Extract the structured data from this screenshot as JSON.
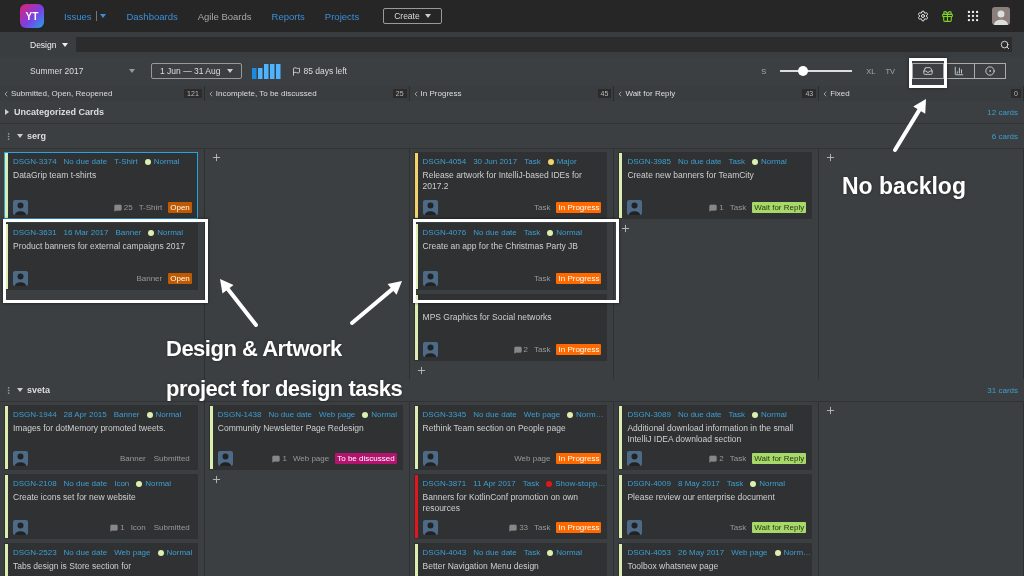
{
  "nav": {
    "logo": "YT",
    "links": [
      {
        "label": "Issues",
        "selected": false,
        "dropdown": true
      },
      {
        "label": "Dashboards",
        "selected": false
      },
      {
        "label": "Agile Boards",
        "selected": true
      },
      {
        "label": "Reports",
        "selected": false
      },
      {
        "label": "Projects",
        "selected": false
      }
    ],
    "create_button": "Create"
  },
  "search": {
    "project": "Design"
  },
  "toolbar": {
    "sprint": "Summer 2017",
    "dates": "1 Jun — 31 Aug",
    "days_left": "85 days left",
    "size_min": "S",
    "size_max": "XL",
    "tv": "TV",
    "level": 0.32
  },
  "columns": [
    {
      "title": "Submitted, Open, Reopened",
      "count": "121"
    },
    {
      "title": "Incomplete, To be discussed",
      "count": "25"
    },
    {
      "title": "In Progress",
      "count": "45"
    },
    {
      "title": "Wait for Reply",
      "count": "43"
    },
    {
      "title": "Fixed",
      "count": "0"
    }
  ],
  "uncategorized": {
    "title": "Uncategorized Cards",
    "count": "12 cards",
    "expanded": false
  },
  "swimlanes": [
    {
      "name": "serg",
      "count": "6 cards",
      "expanded": true,
      "cells": [
        {
          "add": false,
          "cards": [
            {
              "id": "DSGN-3374",
              "date": "No due date",
              "type": "T-Shirt",
              "priority": "Normal",
              "color": "#dcefb0",
              "title": "DataGrip team t-shirts",
              "comments": "25",
              "tag": "T-Shirt",
              "state": {
                "text": "Open",
                "color": "#c05a00"
              },
              "selected": true
            },
            {
              "id": "DSGN-3631",
              "date": "16 Mar 2017",
              "type": "Banner",
              "priority": "Normal",
              "color": "#dcefb0",
              "title": "Product banners for external campaigns 2017",
              "tag": "Banner",
              "state": {
                "text": "Open",
                "color": "#c05a00"
              },
              "selected": false
            }
          ]
        },
        {
          "add": true
        },
        {
          "add": true,
          "cards": [
            {
              "id": "DSGN-4054",
              "date": "30 Jun 2017",
              "type": "Task",
              "priority": "Major",
              "color": "#f2d56a",
              "title": "Release artwork for IntelliJ-based IDEs for 2017.2",
              "tag": "Task",
              "state": {
                "text": "In Progress",
                "color": "#ff6a00"
              },
              "selected": false
            },
            {
              "id": "DSGN-4076",
              "date": "No due date",
              "type": "Task",
              "priority": "Normal",
              "color": "#dcefb0",
              "title": "Create an app for the Christmas Party JB",
              "tag": "Task",
              "state": {
                "text": "In Progress",
                "color": "#ff6a00"
              },
              "selected": false
            },
            {
              "color": "#dcefb0",
              "title": "MPS Graphics for Social networks",
              "comments": "2",
              "tag": "Task",
              "state": {
                "text": "In Progress",
                "color": "#ff6a00"
              },
              "selected": false
            }
          ]
        },
        {
          "add": true,
          "cards": [
            {
              "id": "DSGN-3985",
              "date": "No due date",
              "type": "Task",
              "priority": "Normal",
              "color": "#dcefb0",
              "title": "Create new banners for TeamCity",
              "comments": "1",
              "tag": "Task",
              "state": {
                "text": "Wait for Reply",
                "color": "#a6d96a"
              },
              "selected": false
            }
          ]
        },
        {
          "add": true
        }
      ]
    },
    {
      "name": "sveta",
      "count": "31 cards",
      "expanded": true,
      "cells": [
        {
          "add": false,
          "cards": [
            {
              "id": "DSGN-1944",
              "date": "28 Apr 2015",
              "type": "Banner",
              "priority": "Normal",
              "color": "#dcefb0",
              "title": "Images for dotMemory promoted tweets.",
              "tag": "Banner",
              "state": {
                "text": "Submitted"
              },
              "selected": false
            },
            {
              "id": "DSGN-2108",
              "date": "No due date",
              "type": "Icon",
              "priority": "Normal",
              "color": "#dcefb0",
              "title": "Create icons set for new website",
              "comments": "1",
              "tag": "Icon",
              "state": {
                "text": "Submitted"
              },
              "selected": false
            },
            {
              "id": "DSGN-2523",
              "date": "No due date",
              "type": "Web page",
              "priority": "Normal",
              "color": "#dcefb0",
              "title": "Tabs design is Store section for",
              "selected": false
            }
          ]
        },
        {
          "add": true,
          "cards": [
            {
              "id": "DSGN-1438",
              "date": "No due date",
              "type": "Web page",
              "priority": "Normal",
              "color": "#dcefb0",
              "title": "Community Newsletter Page Redesign",
              "comments": "1",
              "tag": "Web page",
              "state": {
                "text": "To be discussed",
                "color": "#b3126f"
              },
              "selected": false
            }
          ]
        },
        {
          "add": false,
          "cards": [
            {
              "id": "DSGN-3345",
              "date": "No due date",
              "type": "Web page",
              "priority": "Norm…",
              "color": "#dcefb0",
              "title": "Rethink Team section on People page",
              "tag": "Web page",
              "state": {
                "text": "In Progress",
                "color": "#ff6a00"
              },
              "selected": false
            },
            {
              "id": "DSGN-3871",
              "date": "11 Apr 2017",
              "type": "Task",
              "priority": "Show-stopp…",
              "color": "#e3161b",
              "title": "Banners for KotlinConf promotion on own resources",
              "comments": "33",
              "tag": "Task",
              "state": {
                "text": "In Progress",
                "color": "#ff6a00"
              },
              "selected": false
            },
            {
              "id": "DSGN-4043",
              "date": "No due date",
              "type": "Task",
              "priority": "Normal",
              "color": "#dcefb0",
              "title": "Better Navigation Menu design",
              "selected": false
            }
          ]
        },
        {
          "add": false,
          "cards": [
            {
              "id": "DSGN-3089",
              "date": "No due date",
              "type": "Task",
              "priority": "Normal",
              "color": "#dcefb0",
              "title": "Additional download information in the small IntelliJ IDEA download section",
              "comments": "2",
              "tag": "Task",
              "state": {
                "text": "Wait for Reply",
                "color": "#a6d96a"
              },
              "selected": false
            },
            {
              "id": "DSGN-4009",
              "date": "8 May 2017",
              "type": "Task",
              "priority": "Normal",
              "color": "#dcefb0",
              "title": "Please review our enterprise document",
              "tag": "Task",
              "state": {
                "text": "Wait for Reply",
                "color": "#a6d96a"
              },
              "selected": false
            },
            {
              "id": "DSGN-4053",
              "date": "26 May 2017",
              "type": "Web page",
              "priority": "Norm…",
              "color": "#dcefb0",
              "title": "Toolbox whatsnew page",
              "selected": false
            }
          ]
        },
        {
          "add": true
        }
      ]
    }
  ],
  "annotations": {
    "main_label": [
      "Design & Artwork",
      "project for design tasks"
    ],
    "side_label": "No backlog"
  }
}
